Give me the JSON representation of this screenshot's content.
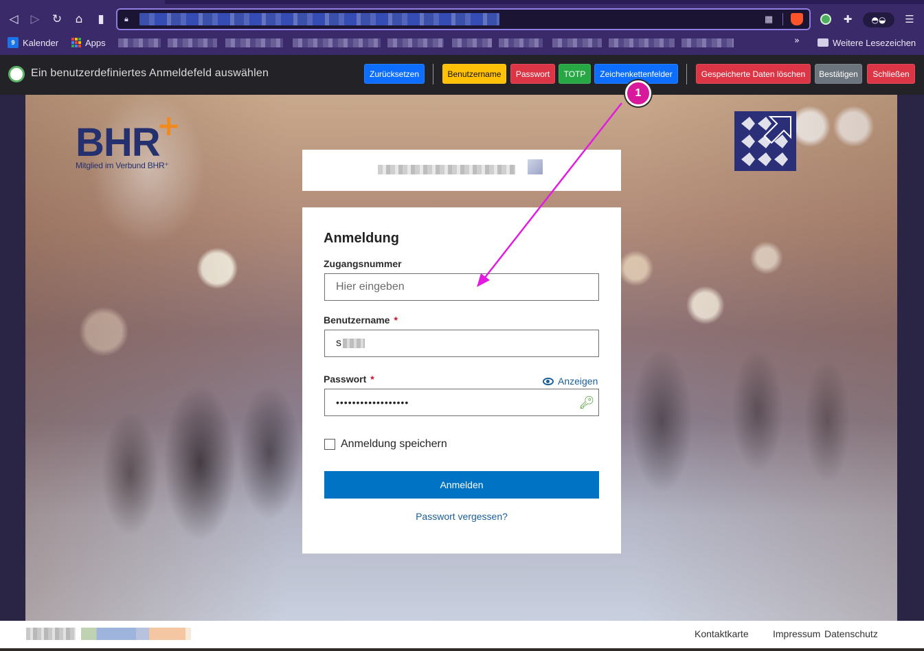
{
  "browser": {
    "bookmarks": {
      "calendar": "Kalender",
      "calendar_icon_text": "9",
      "apps": "Apps",
      "overflow": "»",
      "other_bookmarks": "Weitere Lesezeichen"
    }
  },
  "extension_bar": {
    "title": "Ein benutzerdefiniertes Anmeldefeld auswählen",
    "buttons": {
      "reset": "Zurücksetzen",
      "username": "Benutzername",
      "password": "Passwort",
      "totp": "TOTP",
      "string_fields": "Zeichenkettenfelder",
      "clear_data": "Gespeicherte Daten löschen",
      "confirm": "Bestätigen",
      "close": "Schließen"
    },
    "colors": {
      "blue": "#0d6efd",
      "yellow": "#ffc107",
      "red": "#dc3545",
      "green": "#28a745",
      "gray": "#6c757d"
    }
  },
  "page": {
    "logo": {
      "text": "BHR",
      "plus": "+",
      "subtitle": "Mitglied im Verbund BHR⁺"
    },
    "login": {
      "title": "Anmeldung",
      "access_number": {
        "label": "Zugangsnummer",
        "placeholder": "Hier eingeben",
        "value": ""
      },
      "username": {
        "label": "Benutzername",
        "required_mark": "*",
        "value": "s"
      },
      "password": {
        "label": "Passwort",
        "required_mark": "*",
        "show_label": "Anzeigen",
        "value": "••••••••••••••••••"
      },
      "remember": {
        "label": "Anmeldung speichern",
        "checked": false
      },
      "submit": "Anmelden",
      "forgot": "Passwort vergessen?"
    },
    "footer": {
      "links": [
        "Kontaktkarte",
        "Impressum",
        "Datenschutz"
      ]
    }
  },
  "annotation": {
    "badge": "1",
    "color": "#e21be0"
  }
}
